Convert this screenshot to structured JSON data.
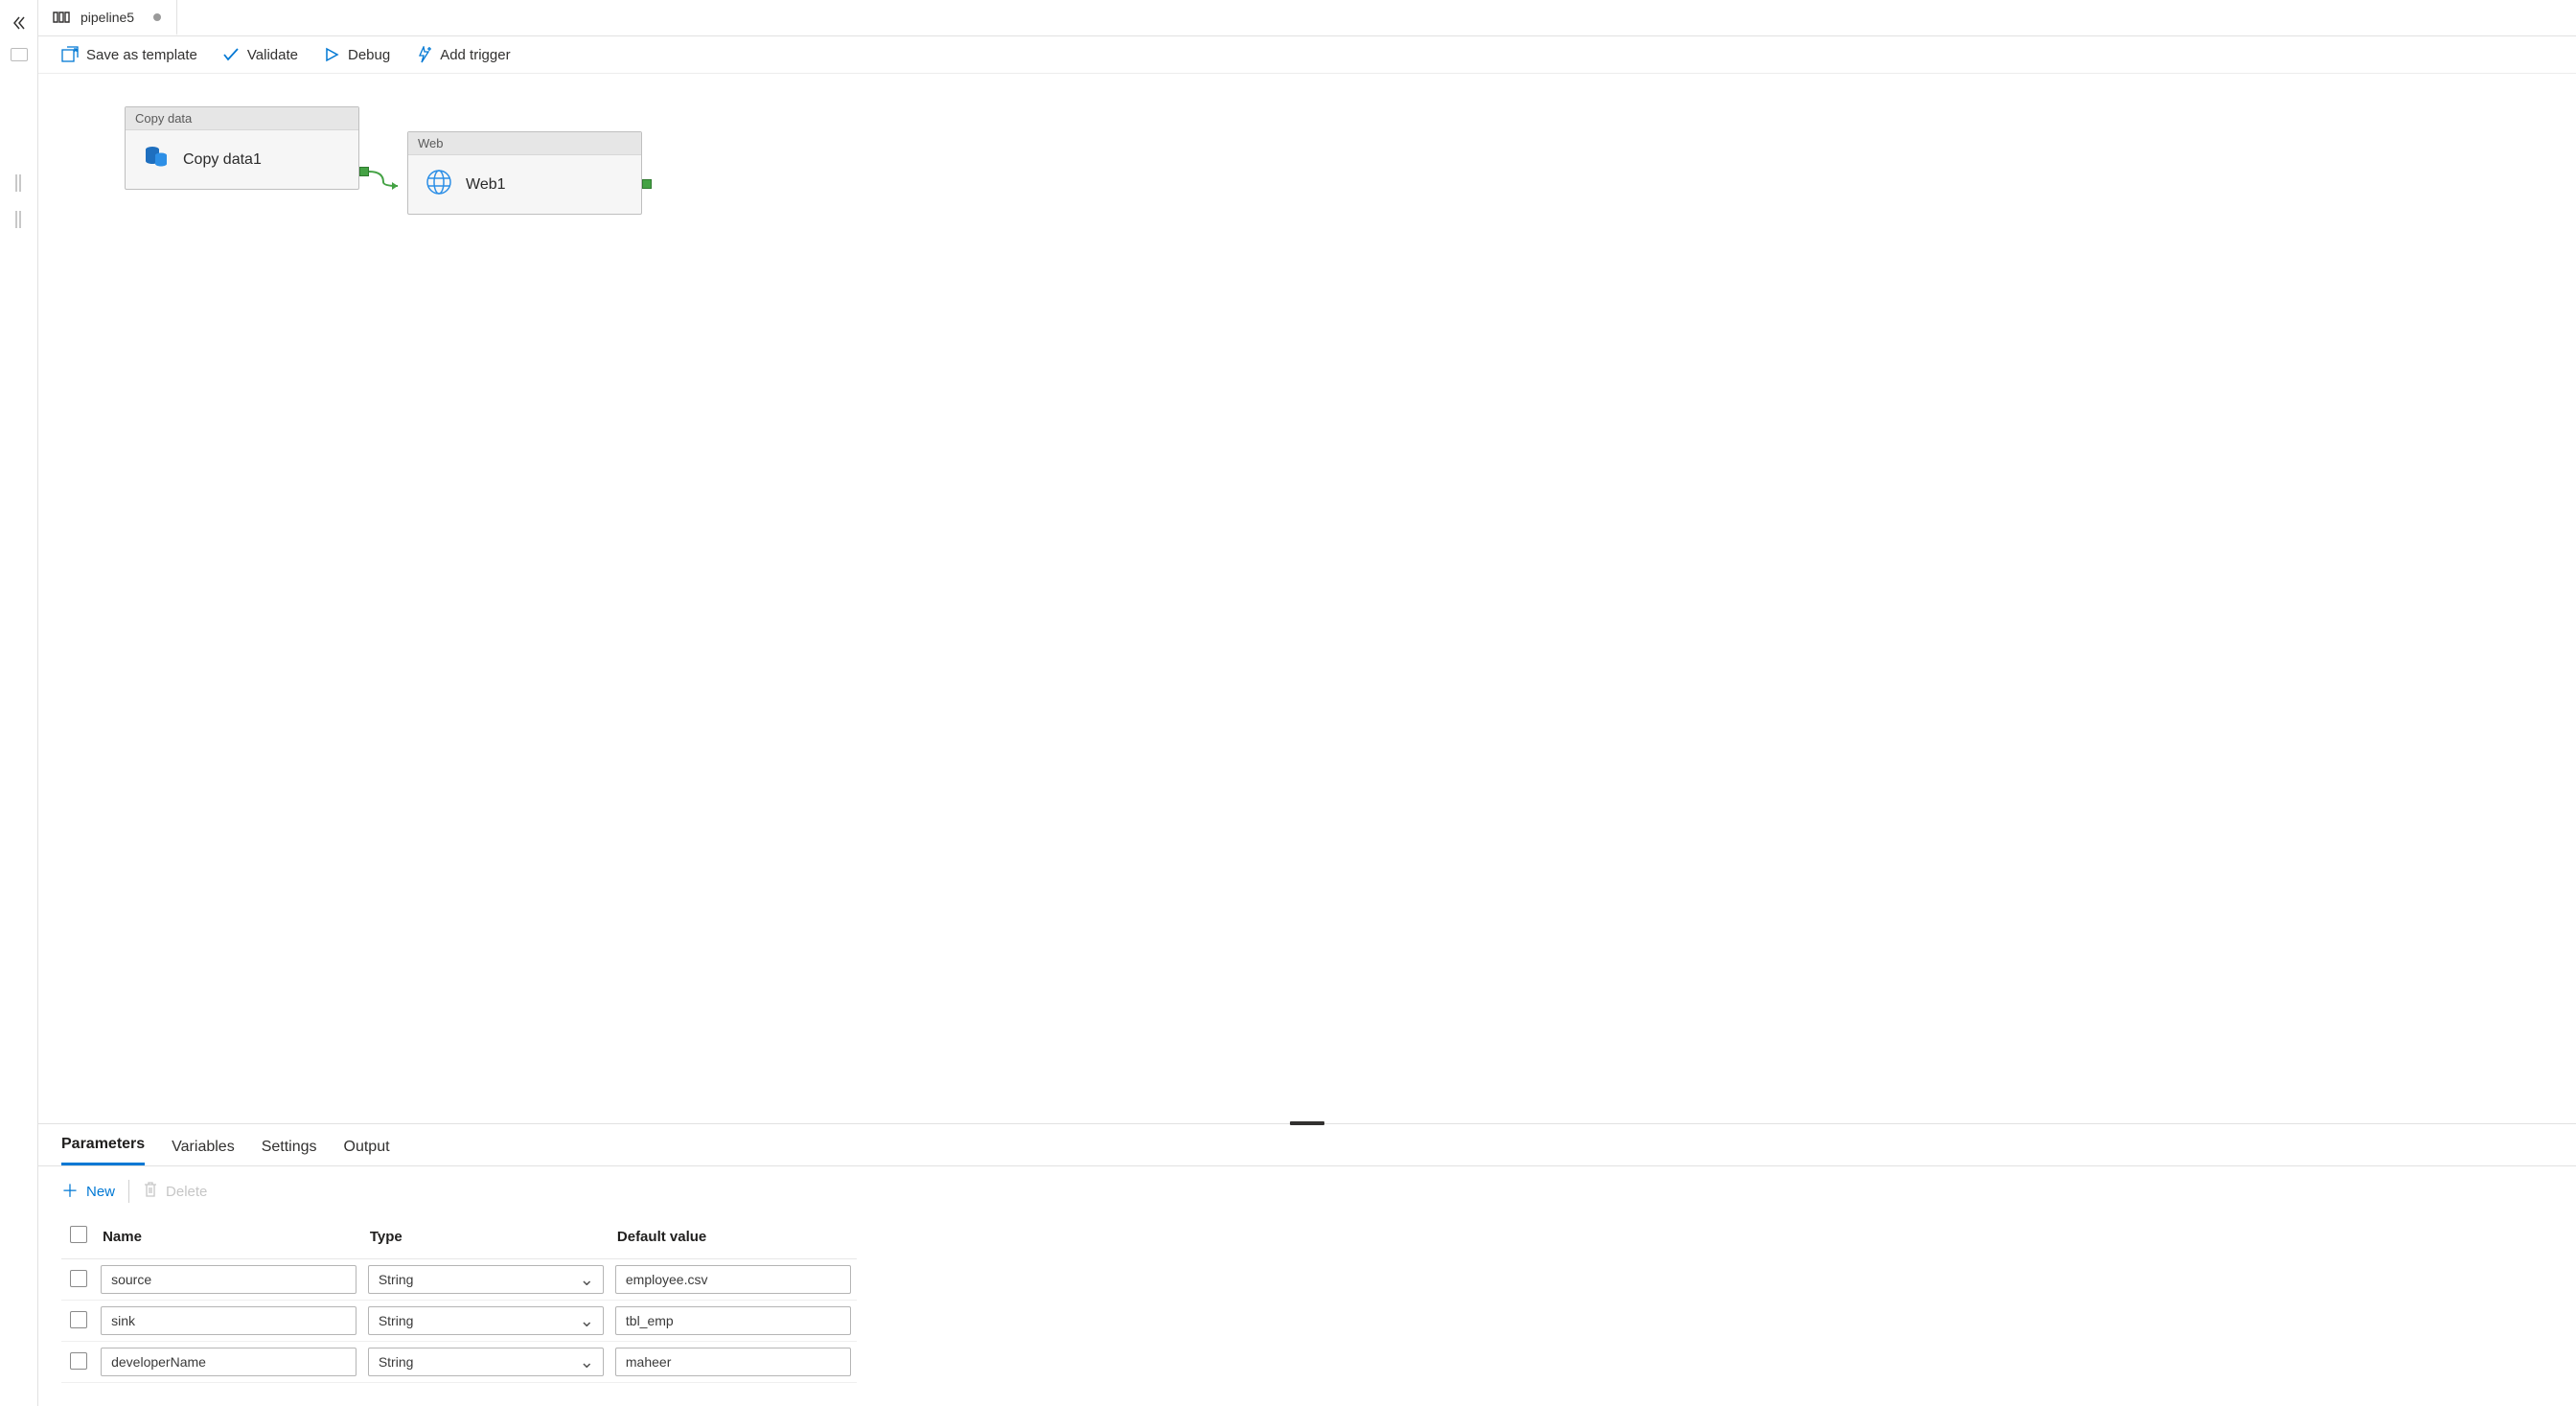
{
  "tab": {
    "title": "pipeline5"
  },
  "toolbar": {
    "save_as_template": "Save as template",
    "validate": "Validate",
    "debug": "Debug",
    "add_trigger": "Add trigger"
  },
  "canvas": {
    "node1": {
      "type": "Copy data",
      "name": "Copy data1"
    },
    "node2": {
      "type": "Web",
      "name": "Web1"
    }
  },
  "panel": {
    "tabs": [
      "Parameters",
      "Variables",
      "Settings",
      "Output"
    ],
    "active_tab": 0
  },
  "param_actions": {
    "new": "New",
    "delete": "Delete"
  },
  "param_headers": {
    "name": "Name",
    "type": "Type",
    "default": "Default value"
  },
  "param_rows": [
    {
      "name": "source",
      "type": "String",
      "default": "employee.csv"
    },
    {
      "name": "sink",
      "type": "String",
      "default": "tbl_emp"
    },
    {
      "name": "developerName",
      "type": "String",
      "default": "maheer"
    }
  ]
}
